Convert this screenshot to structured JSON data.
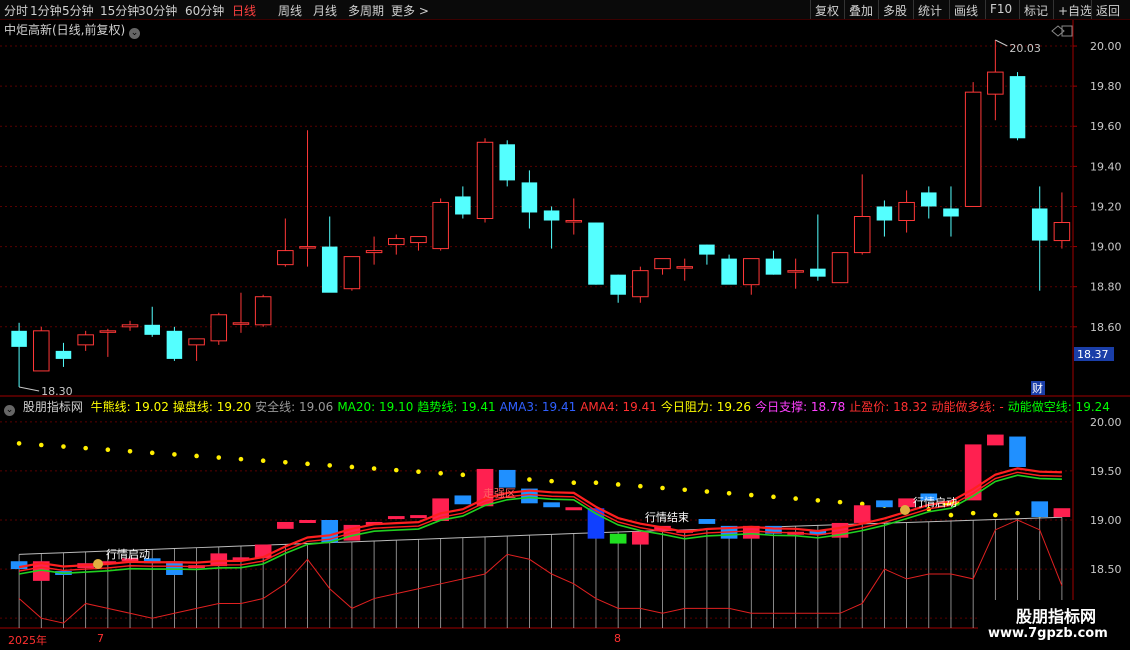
{
  "toolbar": {
    "periods": [
      "分时",
      "1分钟",
      "5分钟",
      "15分钟",
      "30分钟",
      "60分钟",
      "日线",
      "周线",
      "月线",
      "多周期",
      "更多 >"
    ],
    "active_period": "日线",
    "right": [
      "复权",
      "叠加",
      "多股",
      "统计",
      "画线",
      "F10",
      "标记",
      "+自选",
      "返回"
    ]
  },
  "main": {
    "title": "中炬高新(日线,前复权)",
    "y_labels": [
      "20.00",
      "19.80",
      "19.60",
      "19.40",
      "19.20",
      "19.00",
      "18.80",
      "18.60"
    ],
    "current_price": "18.37",
    "high_label": "20.03",
    "low_label": "18.30",
    "cai_badge": "财"
  },
  "indicator": {
    "name": "股朋指标网",
    "items": [
      {
        "label": "牛熊线:",
        "value": "19.02",
        "color": "#ffff00"
      },
      {
        "label": "操盘线:",
        "value": "19.20",
        "color": "#ffff00"
      },
      {
        "label": "安全线:",
        "value": "19.06",
        "color": "#999999"
      },
      {
        "label": "MA20:",
        "value": "19.10",
        "color": "#00ff00"
      },
      {
        "label": "趋势线:",
        "value": "19.41",
        "color": "#00ff00"
      },
      {
        "label": "AMA3:",
        "value": "19.41",
        "color": "#3060ff"
      },
      {
        "label": "AMA4:",
        "value": "19.41",
        "color": "#ff3030"
      },
      {
        "label": "今日阻力:",
        "value": "19.26",
        "color": "#ffff00"
      },
      {
        "label": "今日支撑:",
        "value": "18.78",
        "color": "#ff40ff"
      },
      {
        "label": "止盈价:",
        "value": "18.32",
        "color": "#ff3030"
      },
      {
        "label": "动能做多线:",
        "value": "-",
        "color": "#ff3030"
      },
      {
        "label": "动能做空线:",
        "value": "19.24",
        "color": "#00ff00"
      }
    ],
    "y_labels": [
      "20.00",
      "19.50",
      "19.00",
      "18.50",
      "18.00"
    ],
    "annotations": {
      "start1": "行情启动",
      "end": "行情结束",
      "start2": "行情启动",
      "mid": "走强区"
    }
  },
  "date_axis": {
    "year": "2025年",
    "m7": "7",
    "m8": "8"
  },
  "watermark": {
    "line1": "股朋指标网",
    "line2": "www.7gpzb.com"
  },
  "chart_data": {
    "type": "candlestick",
    "title": "中炬高新(日线,前复权)",
    "ylim": [
      18.26,
      20.04
    ],
    "candles": [
      [
        18.58,
        18.62,
        18.3,
        18.5
      ],
      [
        18.38,
        18.6,
        18.38,
        18.58
      ],
      [
        18.48,
        18.52,
        18.4,
        18.44
      ],
      [
        18.51,
        18.58,
        18.48,
        18.56
      ],
      [
        18.58,
        18.59,
        18.45,
        18.58
      ],
      [
        18.6,
        18.63,
        18.58,
        18.61
      ],
      [
        18.61,
        18.7,
        18.55,
        18.56
      ],
      [
        18.58,
        18.6,
        18.43,
        18.44
      ],
      [
        18.51,
        18.54,
        18.43,
        18.54
      ],
      [
        18.53,
        18.67,
        18.51,
        18.66
      ],
      [
        18.62,
        18.77,
        18.57,
        18.62
      ],
      [
        18.61,
        18.76,
        18.6,
        18.75
      ],
      [
        18.91,
        19.14,
        18.9,
        18.98
      ],
      [
        19.0,
        19.58,
        18.9,
        19.0
      ],
      [
        19.0,
        19.15,
        18.78,
        18.77
      ],
      [
        18.79,
        18.95,
        18.78,
        18.95
      ],
      [
        18.97,
        19.05,
        18.91,
        18.98
      ],
      [
        19.01,
        19.06,
        18.96,
        19.04
      ],
      [
        19.02,
        19.05,
        18.98,
        19.05
      ],
      [
        18.99,
        19.24,
        18.98,
        19.22
      ],
      [
        19.25,
        19.3,
        19.14,
        19.16
      ],
      [
        19.14,
        19.54,
        19.12,
        19.52
      ],
      [
        19.51,
        19.53,
        19.3,
        19.33
      ],
      [
        19.32,
        19.38,
        19.09,
        19.17
      ],
      [
        19.18,
        19.2,
        18.99,
        19.13
      ],
      [
        19.13,
        19.24,
        19.06,
        19.13
      ],
      [
        19.12,
        19.12,
        18.81,
        18.81
      ],
      [
        18.86,
        18.86,
        18.72,
        18.76
      ],
      [
        18.75,
        18.9,
        18.72,
        18.88
      ],
      [
        18.89,
        18.94,
        18.86,
        18.94
      ],
      [
        18.9,
        18.94,
        18.83,
        18.9
      ],
      [
        19.01,
        19.01,
        18.91,
        18.96
      ],
      [
        18.94,
        18.96,
        18.82,
        18.81
      ],
      [
        18.81,
        18.94,
        18.76,
        18.94
      ],
      [
        18.94,
        18.98,
        18.86,
        18.86
      ],
      [
        18.88,
        18.94,
        18.79,
        18.88
      ],
      [
        18.89,
        19.16,
        18.83,
        18.85
      ],
      [
        18.82,
        18.96,
        18.82,
        18.97
      ],
      [
        18.97,
        19.36,
        18.96,
        19.15
      ],
      [
        19.2,
        19.23,
        19.05,
        19.13
      ],
      [
        19.13,
        19.28,
        19.07,
        19.22
      ],
      [
        19.27,
        19.3,
        19.14,
        19.2
      ],
      [
        19.19,
        19.3,
        19.05,
        19.15
      ],
      [
        19.2,
        19.82,
        19.2,
        19.77
      ],
      [
        19.76,
        20.03,
        19.63,
        19.87
      ],
      [
        19.85,
        19.87,
        19.53,
        19.54
      ],
      [
        19.19,
        19.3,
        18.78,
        19.03
      ],
      [
        19.03,
        19.27,
        18.99,
        19.12
      ]
    ]
  }
}
